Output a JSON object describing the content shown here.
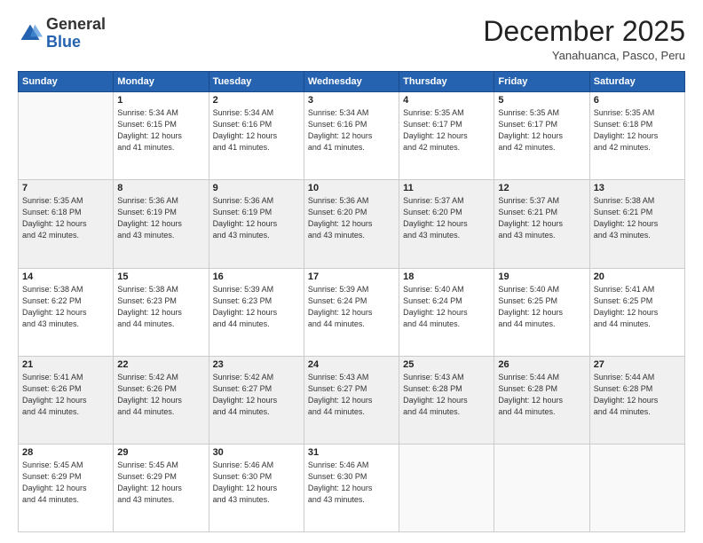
{
  "logo": {
    "general": "General",
    "blue": "Blue"
  },
  "header": {
    "month": "December 2025",
    "location": "Yanahuanca, Pasco, Peru"
  },
  "weekdays": [
    "Sunday",
    "Monday",
    "Tuesday",
    "Wednesday",
    "Thursday",
    "Friday",
    "Saturday"
  ],
  "weeks": [
    [
      {
        "day": "",
        "info": ""
      },
      {
        "day": "1",
        "info": "Sunrise: 5:34 AM\nSunset: 6:15 PM\nDaylight: 12 hours\nand 41 minutes."
      },
      {
        "day": "2",
        "info": "Sunrise: 5:34 AM\nSunset: 6:16 PM\nDaylight: 12 hours\nand 41 minutes."
      },
      {
        "day": "3",
        "info": "Sunrise: 5:34 AM\nSunset: 6:16 PM\nDaylight: 12 hours\nand 41 minutes."
      },
      {
        "day": "4",
        "info": "Sunrise: 5:35 AM\nSunset: 6:17 PM\nDaylight: 12 hours\nand 42 minutes."
      },
      {
        "day": "5",
        "info": "Sunrise: 5:35 AM\nSunset: 6:17 PM\nDaylight: 12 hours\nand 42 minutes."
      },
      {
        "day": "6",
        "info": "Sunrise: 5:35 AM\nSunset: 6:18 PM\nDaylight: 12 hours\nand 42 minutes."
      }
    ],
    [
      {
        "day": "7",
        "info": "Sunrise: 5:35 AM\nSunset: 6:18 PM\nDaylight: 12 hours\nand 42 minutes."
      },
      {
        "day": "8",
        "info": "Sunrise: 5:36 AM\nSunset: 6:19 PM\nDaylight: 12 hours\nand 43 minutes."
      },
      {
        "day": "9",
        "info": "Sunrise: 5:36 AM\nSunset: 6:19 PM\nDaylight: 12 hours\nand 43 minutes."
      },
      {
        "day": "10",
        "info": "Sunrise: 5:36 AM\nSunset: 6:20 PM\nDaylight: 12 hours\nand 43 minutes."
      },
      {
        "day": "11",
        "info": "Sunrise: 5:37 AM\nSunset: 6:20 PM\nDaylight: 12 hours\nand 43 minutes."
      },
      {
        "day": "12",
        "info": "Sunrise: 5:37 AM\nSunset: 6:21 PM\nDaylight: 12 hours\nand 43 minutes."
      },
      {
        "day": "13",
        "info": "Sunrise: 5:38 AM\nSunset: 6:21 PM\nDaylight: 12 hours\nand 43 minutes."
      }
    ],
    [
      {
        "day": "14",
        "info": "Sunrise: 5:38 AM\nSunset: 6:22 PM\nDaylight: 12 hours\nand 43 minutes."
      },
      {
        "day": "15",
        "info": "Sunrise: 5:38 AM\nSunset: 6:23 PM\nDaylight: 12 hours\nand 44 minutes."
      },
      {
        "day": "16",
        "info": "Sunrise: 5:39 AM\nSunset: 6:23 PM\nDaylight: 12 hours\nand 44 minutes."
      },
      {
        "day": "17",
        "info": "Sunrise: 5:39 AM\nSunset: 6:24 PM\nDaylight: 12 hours\nand 44 minutes."
      },
      {
        "day": "18",
        "info": "Sunrise: 5:40 AM\nSunset: 6:24 PM\nDaylight: 12 hours\nand 44 minutes."
      },
      {
        "day": "19",
        "info": "Sunrise: 5:40 AM\nSunset: 6:25 PM\nDaylight: 12 hours\nand 44 minutes."
      },
      {
        "day": "20",
        "info": "Sunrise: 5:41 AM\nSunset: 6:25 PM\nDaylight: 12 hours\nand 44 minutes."
      }
    ],
    [
      {
        "day": "21",
        "info": "Sunrise: 5:41 AM\nSunset: 6:26 PM\nDaylight: 12 hours\nand 44 minutes."
      },
      {
        "day": "22",
        "info": "Sunrise: 5:42 AM\nSunset: 6:26 PM\nDaylight: 12 hours\nand 44 minutes."
      },
      {
        "day": "23",
        "info": "Sunrise: 5:42 AM\nSunset: 6:27 PM\nDaylight: 12 hours\nand 44 minutes."
      },
      {
        "day": "24",
        "info": "Sunrise: 5:43 AM\nSunset: 6:27 PM\nDaylight: 12 hours\nand 44 minutes."
      },
      {
        "day": "25",
        "info": "Sunrise: 5:43 AM\nSunset: 6:28 PM\nDaylight: 12 hours\nand 44 minutes."
      },
      {
        "day": "26",
        "info": "Sunrise: 5:44 AM\nSunset: 6:28 PM\nDaylight: 12 hours\nand 44 minutes."
      },
      {
        "day": "27",
        "info": "Sunrise: 5:44 AM\nSunset: 6:28 PM\nDaylight: 12 hours\nand 44 minutes."
      }
    ],
    [
      {
        "day": "28",
        "info": "Sunrise: 5:45 AM\nSunset: 6:29 PM\nDaylight: 12 hours\nand 44 minutes."
      },
      {
        "day": "29",
        "info": "Sunrise: 5:45 AM\nSunset: 6:29 PM\nDaylight: 12 hours\nand 43 minutes."
      },
      {
        "day": "30",
        "info": "Sunrise: 5:46 AM\nSunset: 6:30 PM\nDaylight: 12 hours\nand 43 minutes."
      },
      {
        "day": "31",
        "info": "Sunrise: 5:46 AM\nSunset: 6:30 PM\nDaylight: 12 hours\nand 43 minutes."
      },
      {
        "day": "",
        "info": ""
      },
      {
        "day": "",
        "info": ""
      },
      {
        "day": "",
        "info": ""
      }
    ]
  ]
}
